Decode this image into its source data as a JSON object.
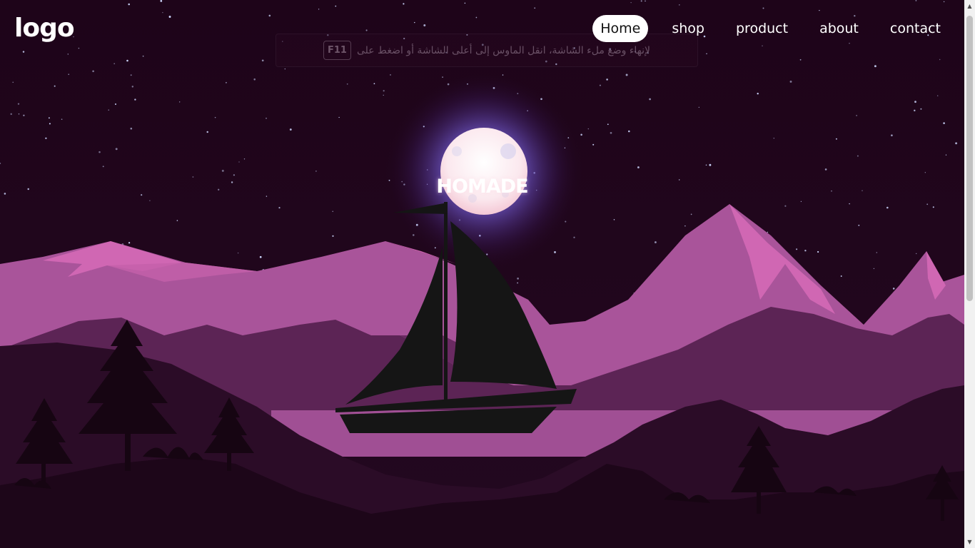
{
  "header": {
    "logo": "logo",
    "nav": [
      {
        "label": "Home",
        "active": true
      },
      {
        "label": "shop",
        "active": false
      },
      {
        "label": "product",
        "active": false
      },
      {
        "label": "about",
        "active": false
      },
      {
        "label": "contact",
        "active": false
      }
    ]
  },
  "fullscreen_tip": {
    "text": "لإنهاء وضع ملء الشاشة، انقل الماوس إلى أعلى الشاشة أو اضغط على",
    "key": "F11"
  },
  "hero": {
    "title": "HOMADE"
  },
  "scrollbar": {
    "up_icon": "triangle-up",
    "down_icon": "triangle-down"
  },
  "colors": {
    "sky": "#1c0518",
    "moon": "#fbeef4",
    "moon_glow": "#8c7bff",
    "mountain_far": "#a9549a",
    "mountain_highlight": "#d067b3",
    "hills_mid": "#5c2455",
    "hills_dark": "#2b0c27",
    "boat": "#151515",
    "nav_active_bg": "#ffffff"
  }
}
